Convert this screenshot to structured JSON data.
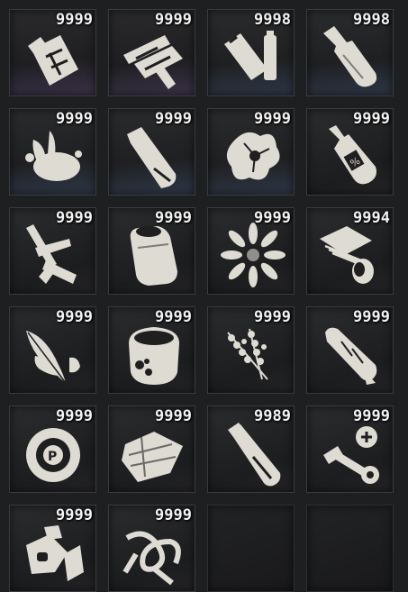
{
  "inventory": {
    "slots": [
      {
        "icon": "jerrycan-icon",
        "count": "9999",
        "tint": "purple"
      },
      {
        "icon": "wire-connectors-icon",
        "count": "9999",
        "tint": "purple"
      },
      {
        "icon": "batteries-icon",
        "count": "9998",
        "tint": "blue"
      },
      {
        "icon": "bottle-icon",
        "count": "9998",
        "tint": "blue"
      },
      {
        "icon": "splash-stain-icon",
        "count": "9999",
        "tint": "blue"
      },
      {
        "icon": "tube-icon",
        "count": "9999",
        "tint": "blue"
      },
      {
        "icon": "flower-petals-icon",
        "count": "9999",
        "tint": "blue"
      },
      {
        "icon": "alcohol-bottle-icon",
        "count": "9999",
        "tint": ""
      },
      {
        "icon": "scalpel-blades-icon",
        "count": "9999",
        "tint": ""
      },
      {
        "icon": "soda-can-icon",
        "count": "9999",
        "tint": ""
      },
      {
        "icon": "daisy-flower-icon",
        "count": "9999",
        "tint": ""
      },
      {
        "icon": "circuit-capacitor-icon",
        "count": "9994",
        "tint": ""
      },
      {
        "icon": "feathers-icon",
        "count": "9999",
        "tint": ""
      },
      {
        "icon": "jar-icon",
        "count": "9999",
        "tint": ""
      },
      {
        "icon": "lavender-herb-icon",
        "count": "9999",
        "tint": ""
      },
      {
        "icon": "rolled-paper-icon",
        "count": "9999",
        "tint": ""
      },
      {
        "icon": "tape-roll-icon",
        "count": "9999",
        "tint": ""
      },
      {
        "icon": "cloth-rags-icon",
        "count": "9999",
        "tint": ""
      },
      {
        "icon": "vial-icon",
        "count": "9989",
        "tint": ""
      },
      {
        "icon": "bolts-screws-icon",
        "count": "9999",
        "tint": ""
      },
      {
        "icon": "metal-scrap-icon",
        "count": "9999",
        "tint": ""
      },
      {
        "icon": "rope-knot-icon",
        "count": "9999",
        "tint": ""
      },
      {
        "icon": "",
        "count": "",
        "tint": ""
      },
      {
        "icon": "",
        "count": "",
        "tint": ""
      }
    ]
  },
  "colors": {
    "icon": "#dedbd3",
    "icon_dark": "#1f1f20",
    "count_text": "#f2f2f2"
  }
}
